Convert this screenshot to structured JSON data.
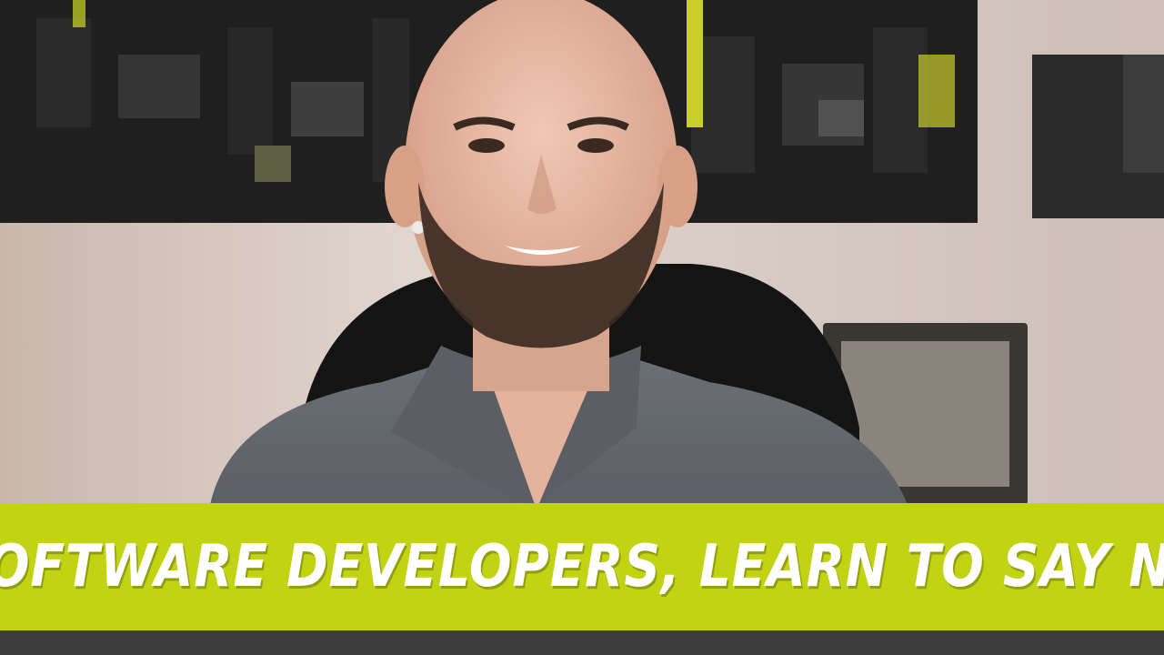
{
  "banner": {
    "title": "SOFTWARE DEVELOPERS, LEARN TO SAY NO",
    "background_color": "#c2d313",
    "text_color": "#ffffff"
  },
  "colors": {
    "wall": "#d6c9c2",
    "shelf_dark": "#1e1e1e",
    "accent_yellow": "#d7de2a",
    "shirt": "#5a5e63",
    "skin": "#e6b9a3",
    "beard": "#3a2a22",
    "chair": "#151515"
  }
}
